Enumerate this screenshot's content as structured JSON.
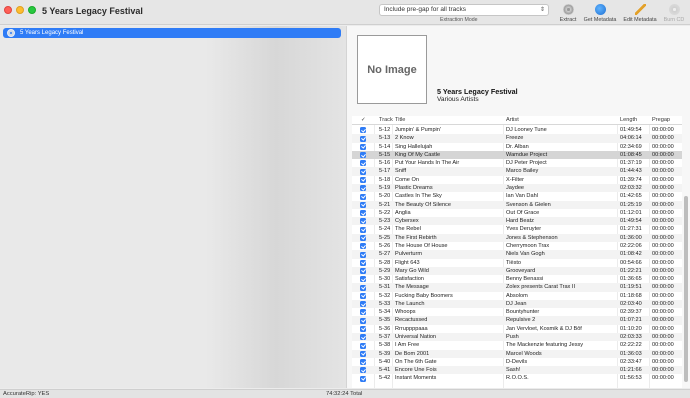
{
  "window": {
    "title": "5 Years Legacy Festival"
  },
  "toolbar": {
    "extraction_mode_value": "Include pre-gap for all tracks",
    "extraction_mode_caption": "Extraction Mode",
    "buttons": [
      {
        "label": "Extract",
        "icon": "extract-icon",
        "enabled": true
      },
      {
        "label": "Get Metadata",
        "icon": "globe-icon",
        "enabled": true
      },
      {
        "label": "Edit Metadata",
        "icon": "pencil-icon",
        "enabled": true
      },
      {
        "label": "Burn CD",
        "icon": "burn-icon",
        "enabled": false
      }
    ]
  },
  "sidebar": {
    "items": [
      {
        "label": "5 Years Legacy Festival"
      }
    ]
  },
  "album": {
    "cover_text": "No Image",
    "title": "5 Years Legacy Festival",
    "artist": "Various Artists"
  },
  "table": {
    "headers": {
      "check": "✓",
      "track": "Track",
      "title": "Title",
      "artist": "Artist",
      "length": "Length",
      "pregap": "Pregap"
    },
    "selected_row": 3,
    "rows": [
      {
        "track": "5-12",
        "title": "Jumpin' & Pumpin'",
        "artist": "DJ Looney Tune",
        "length": "01:49:54",
        "pregap": "00:00:00"
      },
      {
        "track": "5-13",
        "title": "2 Know",
        "artist": "Freeze",
        "length": "04:06:14",
        "pregap": "00:00:00"
      },
      {
        "track": "5-14",
        "title": "Sing Hallelujah",
        "artist": "Dr. Alban",
        "length": "02:34:69",
        "pregap": "00:00:00"
      },
      {
        "track": "5-15",
        "title": "King Of My Castle",
        "artist": "Wamdue Project",
        "length": "01:08:45",
        "pregap": "00:00:00"
      },
      {
        "track": "5-16",
        "title": "Put Your Hands In The Air",
        "artist": "DJ Peter Project",
        "length": "01:37:19",
        "pregap": "00:00:00"
      },
      {
        "track": "5-17",
        "title": "Sniff",
        "artist": "Marco Bailey",
        "length": "01:44:43",
        "pregap": "00:00:00"
      },
      {
        "track": "5-18",
        "title": "Come On",
        "artist": "X-Filter",
        "length": "01:39:74",
        "pregap": "00:00:00"
      },
      {
        "track": "5-19",
        "title": "Plastic Dreams",
        "artist": "Jaydee",
        "length": "02:03:32",
        "pregap": "00:00:00"
      },
      {
        "track": "5-20",
        "title": "Castles In The Sky",
        "artist": "Ian Van Dahl",
        "length": "01:42:65",
        "pregap": "00:00:00"
      },
      {
        "track": "5-21",
        "title": "The Beauty Of Silence",
        "artist": "Svenson & Gielen",
        "length": "01:25:19",
        "pregap": "00:00:00"
      },
      {
        "track": "5-22",
        "title": "Anglia",
        "artist": "Out Of Grace",
        "length": "01:12:01",
        "pregap": "00:00:00"
      },
      {
        "track": "5-23",
        "title": "Cybersex",
        "artist": "Hard Beatz",
        "length": "01:49:54",
        "pregap": "00:00:00"
      },
      {
        "track": "5-24",
        "title": "The Rebel",
        "artist": "Yves Deruyter",
        "length": "01:27:31",
        "pregap": "00:00:00"
      },
      {
        "track": "5-25",
        "title": "The First Rebirth",
        "artist": "Jones & Stephenson",
        "length": "01:36:00",
        "pregap": "00:00:00"
      },
      {
        "track": "5-26",
        "title": "The House Of House",
        "artist": "Cherrymoon Trax",
        "length": "02:22:06",
        "pregap": "00:00:00"
      },
      {
        "track": "5-27",
        "title": "Pulverturm",
        "artist": "Niels Van Gogh",
        "length": "01:08:42",
        "pregap": "00:00:00"
      },
      {
        "track": "5-28",
        "title": "Flight 643",
        "artist": "Tiësto",
        "length": "00:54:66",
        "pregap": "00:00:00"
      },
      {
        "track": "5-29",
        "title": "Mary Go Wild",
        "artist": "Grooveyard",
        "length": "01:22:21",
        "pregap": "00:00:00"
      },
      {
        "track": "5-30",
        "title": "Satisfaction",
        "artist": "Benny Benassi",
        "length": "01:36:65",
        "pregap": "00:00:00"
      },
      {
        "track": "5-31",
        "title": "The Message",
        "artist": "Zolex presents Carat Trax II",
        "length": "01:19:51",
        "pregap": "00:00:00"
      },
      {
        "track": "5-32",
        "title": "Fucking Baby Boomers",
        "artist": "Absolom",
        "length": "01:18:68",
        "pregap": "00:00:00"
      },
      {
        "track": "5-33",
        "title": "The Launch",
        "artist": "DJ Jean",
        "length": "02:03:40",
        "pregap": "00:00:00"
      },
      {
        "track": "5-34",
        "title": "Whoops",
        "artist": "Bountyhunter",
        "length": "02:39:37",
        "pregap": "00:00:00"
      },
      {
        "track": "5-35",
        "title": "Recactussed",
        "artist": "Repulsive 2",
        "length": "01:07:21",
        "pregap": "00:00:00"
      },
      {
        "track": "5-36",
        "title": "Rrruppppaaa",
        "artist": "Jan Vervloet, Kosmik & DJ Bôf",
        "length": "01:10:20",
        "pregap": "00:00:00"
      },
      {
        "track": "5-37",
        "title": "Universal Nation",
        "artist": "Push",
        "length": "02:03:33",
        "pregap": "00:00:00"
      },
      {
        "track": "5-38",
        "title": "I Am Free",
        "artist": "The Mackenzie featuring Jessy",
        "length": "02:22:22",
        "pregap": "00:00:00"
      },
      {
        "track": "5-39",
        "title": "De Bom 2001",
        "artist": "Marcel Woods",
        "length": "01:36:03",
        "pregap": "00:00:00"
      },
      {
        "track": "5-40",
        "title": "On The 6th Gate",
        "artist": "D-Devils",
        "length": "02:33:47",
        "pregap": "00:00:00"
      },
      {
        "track": "5-41",
        "title": "Encore Une Fois",
        "artist": "Sash!",
        "length": "01:21:66",
        "pregap": "00:00:00"
      },
      {
        "track": "5-42",
        "title": "Instant Moments",
        "artist": "R.O.O.S.",
        "length": "01:56:53",
        "pregap": "00:00:00"
      }
    ]
  },
  "status": {
    "accuraterip": "AccurateRip: YES",
    "total": "74:32:24 Total"
  },
  "colors": {
    "accent": "#2f7cf6",
    "selected_row": "#d5d5d5"
  }
}
